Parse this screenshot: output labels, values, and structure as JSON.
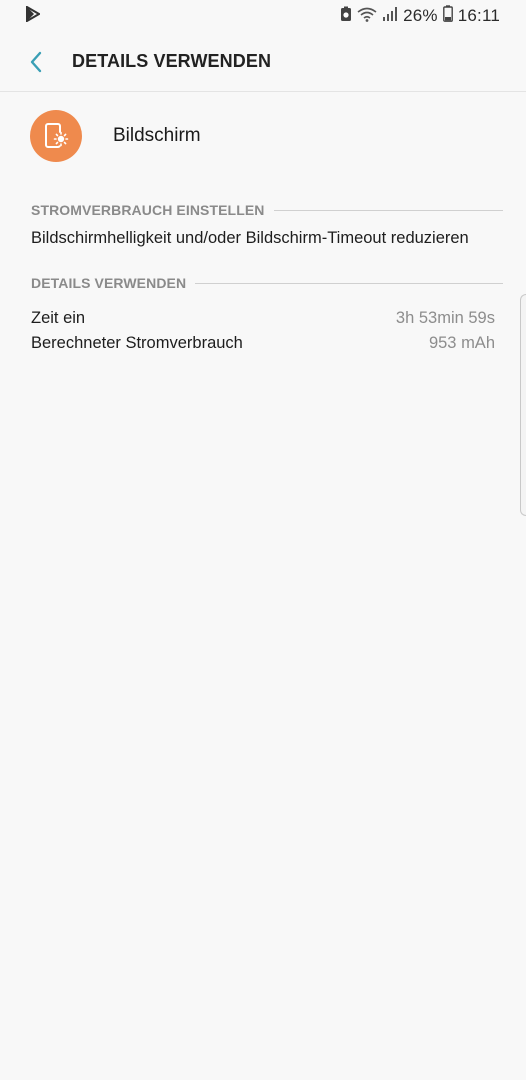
{
  "status_bar": {
    "battery_percent": "26%",
    "time": "16:11"
  },
  "header": {
    "title": "DETAILS VERWENDEN"
  },
  "app": {
    "name": "Bildschirm",
    "icon": "screen-brightness-icon",
    "icon_color": "#ef8a4d"
  },
  "sections": {
    "power_settings": {
      "title": "STROMVERBRAUCH EINSTELLEN",
      "tip": "Bildschirmhelligkeit und/oder Bildschirm-Timeout reduzieren"
    },
    "usage_details": {
      "title": "DETAILS VERWENDEN",
      "rows": [
        {
          "label": "Zeit ein",
          "value": "3h 53min 59s"
        },
        {
          "label": "Berechneter Stromverbrauch",
          "value": "953 mAh"
        }
      ]
    }
  },
  "colors": {
    "accent_back": "#3a9fb5",
    "background": "#f8f8f8"
  }
}
